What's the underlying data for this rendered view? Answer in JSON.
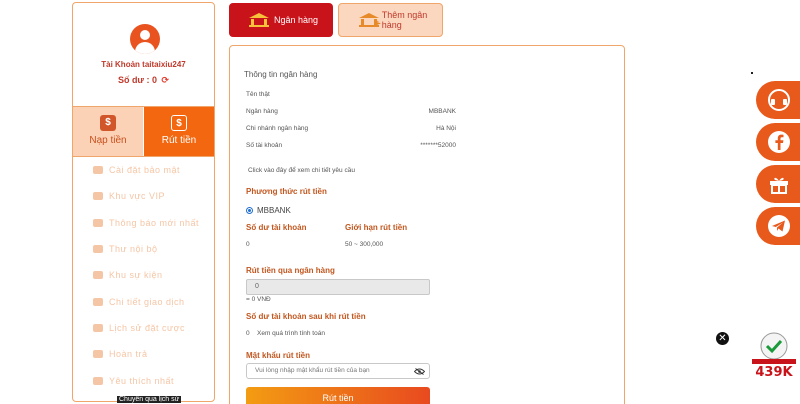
{
  "sidebar": {
    "account_label": "Tài Khoản",
    "username": "taitaixiu247",
    "balance_label": "Số dư :",
    "balance_value": "0",
    "deposit_label": "Nạp tiền",
    "withdraw_label": "Rút tiền",
    "menu": [
      {
        "label": "Cài đặt bảo mật",
        "icon": "user-shield-icon"
      },
      {
        "label": "Khu vực VIP",
        "icon": "vip-user-icon"
      },
      {
        "label": "Thông báo mới nhất",
        "icon": "megaphone-icon"
      },
      {
        "label": "Thư nội bộ",
        "icon": "mail-icon"
      },
      {
        "label": "Khu sự kiện",
        "icon": "trophy-icon"
      },
      {
        "label": "Chi tiết giao dịch",
        "icon": "document-icon"
      },
      {
        "label": "Lịch sử đặt cược",
        "icon": "history-icon"
      },
      {
        "label": "Hoàn trả",
        "icon": "refund-icon"
      },
      {
        "label": "Yêu thích nhất",
        "icon": "heart-icon"
      }
    ],
    "tooltip": "Chuyển qua lịch sử"
  },
  "tabs": {
    "bank": "Ngân hàng",
    "add_bank": "Thêm ngân hàng"
  },
  "bank_info": {
    "title": "Thông tin ngân hàng",
    "real_name_label": "Tên thật",
    "bank_label": "Ngân hàng",
    "bank_value": "MBBANK",
    "branch_label": "Chi nhánh ngân hàng",
    "branch_value": "Hà Nội",
    "account_label": "Số tài khoản",
    "account_value": "*******52000",
    "details_link": "Click vào đây để xem chi tiết yêu cầu"
  },
  "withdraw": {
    "method_label": "Phương thức rút tiền",
    "method_option": "MBBANK",
    "balance_label": "Số dư tài khoản",
    "balance_value": "0",
    "limit_label": "Giới hạn rút tiền",
    "limit_value": "50 ~ 300,000",
    "amount_label": "Rút tiền qua ngân hàng",
    "amount_value": "0",
    "amount_vnd": "= 0 VNĐ",
    "after_label": "Số dư tài khoản sau khi rút tiền",
    "after_value": "0",
    "after_note": "Xem quá trình tính toán",
    "password_label": "Mật khẩu rút tiền",
    "password_placeholder": "Vui lòng nhập mật khẩu rút tiền của bạn",
    "submit_label": "Rút tiền"
  },
  "floating": {
    "badge_text": "439K",
    "close_symbol": "✕"
  },
  "colors": {
    "accent_orange": "#f2670f",
    "brand_red": "#c9131b",
    "border_orange": "#f0a66a"
  }
}
